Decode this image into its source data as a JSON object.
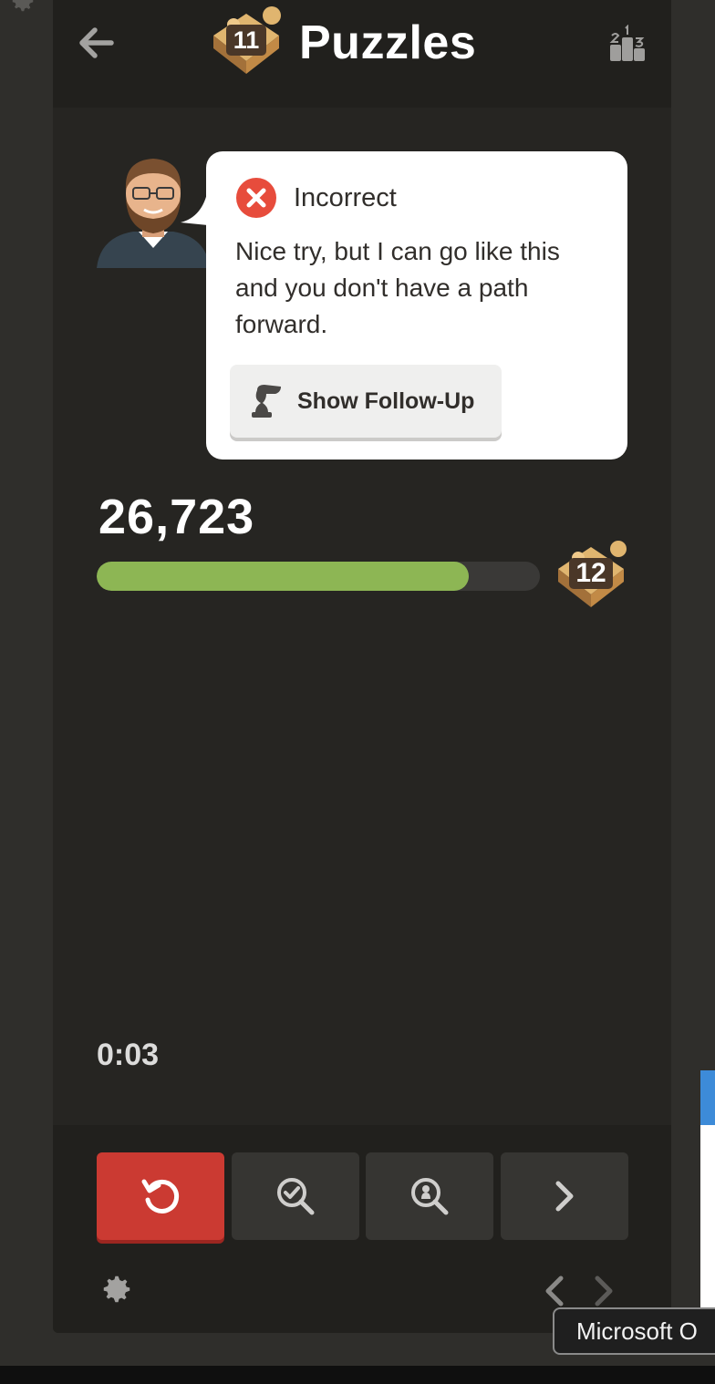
{
  "header": {
    "title": "Puzzles",
    "current_level": "11"
  },
  "feedback": {
    "status": "Incorrect",
    "message": "Nice try, but I can go like this and you don't have a path forward.",
    "followup_label": "Show Follow-Up"
  },
  "rating": {
    "score": "26,723",
    "progress_percent": 84,
    "next_level": "12"
  },
  "timer": {
    "elapsed": "0:03"
  },
  "tooltip": {
    "text": "Microsoft O"
  },
  "colors": {
    "accent_green": "#8db654",
    "retry_red": "#cb3a32",
    "incorrect_red": "#e74c3c"
  },
  "icons": {
    "back": "arrow-left-icon",
    "leaderboard": "podium-icon",
    "incorrect": "x-circle-icon",
    "followup": "chess-piece-icon",
    "retry": "retry-icon",
    "hint": "magnify-check-icon",
    "solution": "magnify-piece-icon",
    "next": "chevron-right-icon",
    "settings": "gear-icon"
  }
}
